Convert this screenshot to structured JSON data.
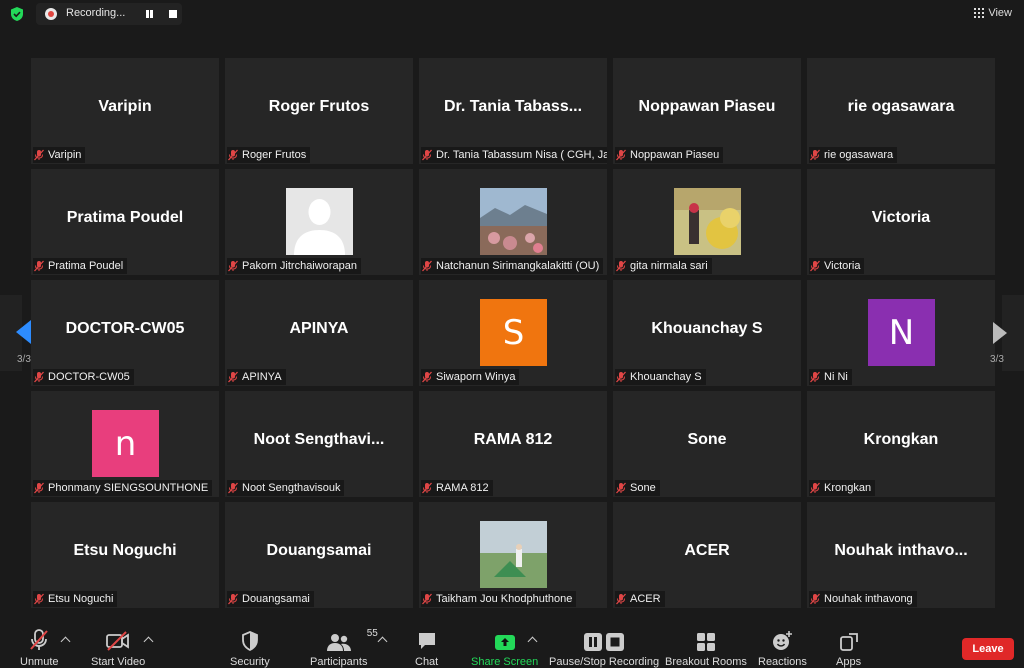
{
  "recording": {
    "text": "Recording..."
  },
  "view": {
    "label": "View"
  },
  "participants_grid": [
    {
      "display": "Varipin",
      "label": "Varipin",
      "kind": "name"
    },
    {
      "display": "Roger Frutos",
      "label": "Roger Frutos",
      "kind": "name"
    },
    {
      "display": "Dr. Tania Tabass...",
      "label": "Dr. Tania Tabassum Nisa ( CGH, Ja...",
      "kind": "name"
    },
    {
      "display": "Noppawan Piaseu",
      "label": "Noppawan Piaseu",
      "kind": "name"
    },
    {
      "display": "rie ogasawara",
      "label": "rie ogasawara",
      "kind": "name"
    },
    {
      "display": "Pratima Poudel",
      "label": "Pratima Poudel",
      "kind": "name"
    },
    {
      "display": "",
      "label": "Pakorn Jitrchaiworapan",
      "kind": "silhouette"
    },
    {
      "display": "",
      "label": "Natchanun Sirimangkalakitti (OU)",
      "kind": "photo-mountain"
    },
    {
      "display": "",
      "label": "gita nirmala sari",
      "kind": "photo-field"
    },
    {
      "display": "Victoria",
      "label": "Victoria",
      "kind": "name"
    },
    {
      "display": "DOCTOR-CW05",
      "label": "DOCTOR-CW05",
      "kind": "name"
    },
    {
      "display": "APINYA",
      "label": "APINYA",
      "kind": "name"
    },
    {
      "display": "S",
      "label": "Siwaporn Winya",
      "kind": "letter",
      "color": "#f0750f"
    },
    {
      "display": "Khouanchay S",
      "label": "Khouanchay S",
      "kind": "name"
    },
    {
      "display": "N",
      "label": "Ni Ni",
      "kind": "letter",
      "color": "#8a2fb0"
    },
    {
      "display": "n",
      "label": "Phonmany SIENGSOUNTHONE",
      "kind": "letter",
      "color": "#e83e7d"
    },
    {
      "display": "Noot Sengthavi...",
      "label": "Noot Sengthavisouk",
      "kind": "name"
    },
    {
      "display": "RAMA 812",
      "label": "RAMA 812",
      "kind": "name"
    },
    {
      "display": "Sone",
      "label": "Sone",
      "kind": "name"
    },
    {
      "display": "Krongkan",
      "label": "Krongkan",
      "kind": "name"
    },
    {
      "display": "Etsu Noguchi",
      "label": "Etsu Noguchi",
      "kind": "name"
    },
    {
      "display": "Douangsamai",
      "label": "Douangsamai",
      "kind": "name"
    },
    {
      "display": "",
      "label": "Taikham Jou Khodphuthone",
      "kind": "photo-tent"
    },
    {
      "display": "ACER",
      "label": "ACER",
      "kind": "name"
    },
    {
      "display": "Nouhak inthavo...",
      "label": "Nouhak inthavong",
      "kind": "name"
    }
  ],
  "pagination": {
    "left": "3/3",
    "right": "3/3"
  },
  "toolbar": {
    "unmute": "Unmute",
    "start_video": "Start Video",
    "security": "Security",
    "participants": "Participants",
    "participants_count": "55",
    "chat": "Chat",
    "share_screen": "Share Screen",
    "pause_stop_recording": "Pause/Stop Recording",
    "breakout_rooms": "Breakout Rooms",
    "reactions": "Reactions",
    "apps": "Apps",
    "leave": "Leave"
  },
  "colors": {
    "accent": "#2d8cff",
    "share_green": "#23d959",
    "leave_red": "#e02828",
    "muted_red": "#e04646"
  }
}
